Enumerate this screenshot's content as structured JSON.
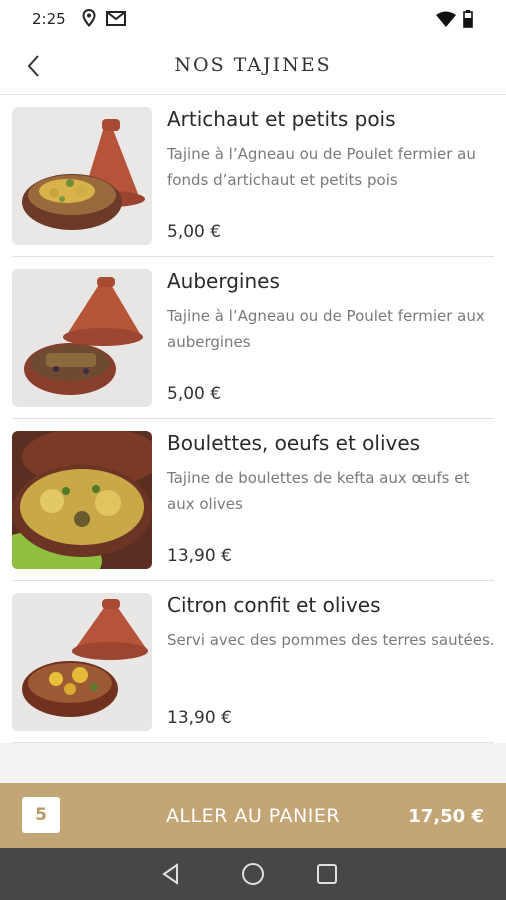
{
  "status": {
    "time": "2:25"
  },
  "header": {
    "title": "NOS TAJINES"
  },
  "items": [
    {
      "name": "Artichaut et petits pois",
      "description": "Tajine à l’Agneau ou de Poulet fermier au fonds d’artichaut et petits pois",
      "price": "5,00 €"
    },
    {
      "name": "Aubergines",
      "description": "Tajine à l’Agneau ou de Poulet fermier aux aubergines",
      "price": "5,00 €"
    },
    {
      "name": "Boulettes, oeufs et olives",
      "description": "Tajine de boulettes de kefta aux œufs et aux olives",
      "price": "13,90 €"
    },
    {
      "name": "Citron confit et olives",
      "description": "Servi avec des pommes des terres sautées.",
      "price": "13,90 €"
    }
  ],
  "cart": {
    "count": "5",
    "label": "ALLER AU PANIER",
    "total": "17,50 €"
  },
  "colors": {
    "accent": "#c3a576",
    "nav_bar": "#474747",
    "clay": "#b5543a"
  },
  "icons": {
    "status": [
      "location-icon",
      "gmail-icon",
      "wifi-icon",
      "battery-icon"
    ],
    "nav": [
      "back-triangle-icon",
      "home-circle-icon",
      "recents-square-icon"
    ]
  }
}
